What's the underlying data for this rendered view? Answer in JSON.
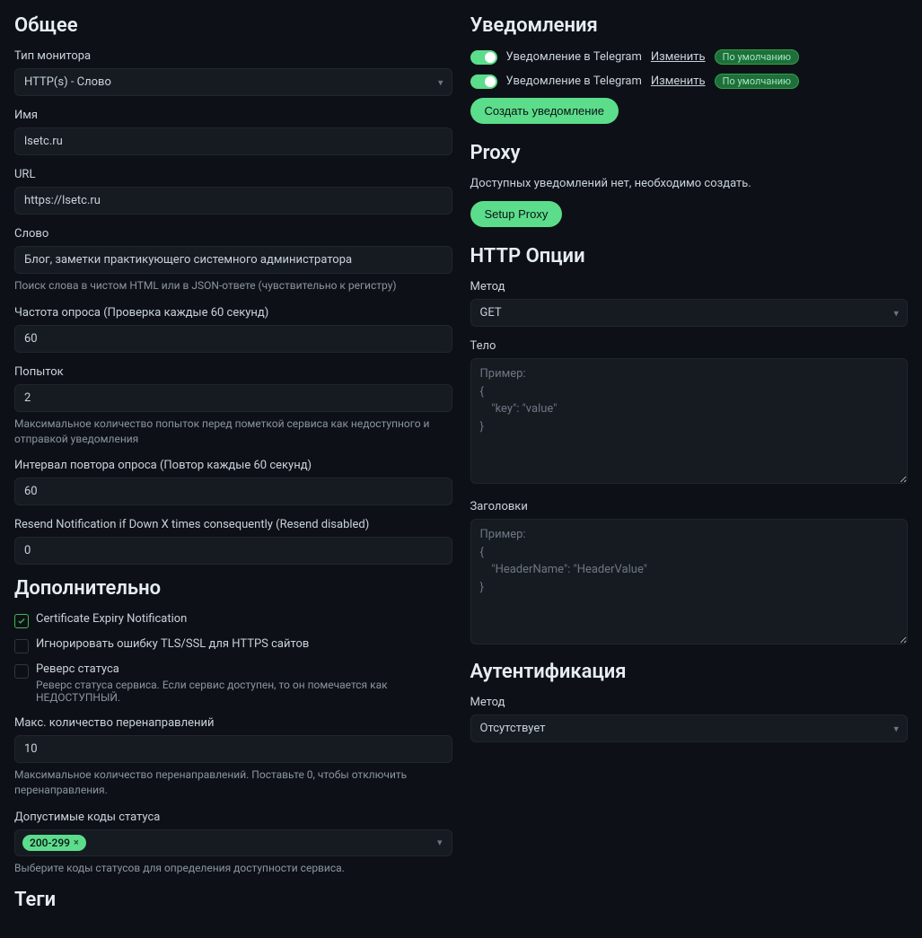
{
  "left": {
    "general": {
      "title": "Общее",
      "monitor_type": {
        "label": "Тип монитора",
        "value": "HTTP(s) - Слово"
      },
      "name": {
        "label": "Имя",
        "value": "lsetc.ru"
      },
      "url": {
        "label": "URL",
        "value": "https://lsetc.ru"
      },
      "word": {
        "label": "Слово",
        "value": "Блог, заметки практикующего системного администратора",
        "help": "Поиск слова в чистом HTML или в JSON-ответе (чувствительно к регистру)"
      },
      "interval": {
        "label": "Частота опроса (Проверка каждые 60 секунд)",
        "value": "60"
      },
      "retries": {
        "label": "Попыток",
        "value": "2",
        "help": "Максимальное количество попыток перед пометкой сервиса как недоступного и отправкой уведомления"
      },
      "retry_interval": {
        "label": "Интервал повтора опроса (Повтор каждые 60 секунд)",
        "value": "60"
      },
      "resend": {
        "label": "Resend Notification if Down X times consequently (Resend disabled)",
        "value": "0"
      }
    },
    "advanced": {
      "title": "Дополнительно",
      "cert_expiry": {
        "label": "Certificate Expiry Notification",
        "checked": true
      },
      "ignore_tls": {
        "label": "Игнорировать ошибку TLS/SSL для HTTPS сайтов",
        "checked": false
      },
      "upside_down": {
        "label": "Реверс статуса",
        "sub": "Реверс статуса сервиса. Если сервис доступен, то он помечается как НЕДОСТУПНЫЙ.",
        "checked": false
      },
      "max_redirects": {
        "label": "Макс. количество перенаправлений",
        "value": "10",
        "help": "Максимальное количество перенаправлений. Поставьте 0, чтобы отключить перенаправления."
      },
      "status_codes": {
        "label": "Допустимые коды статуса",
        "tag": "200-299",
        "help": "Выберите коды статусов для определения доступности сервиса."
      }
    },
    "tags": {
      "title": "Теги"
    }
  },
  "right": {
    "notifications": {
      "title": "Уведомления",
      "items": [
        {
          "text": "Уведомление в Telegram",
          "edit": "Изменить",
          "badge": "По умолчанию"
        },
        {
          "text": "Уведомление в Telegram",
          "edit": "Изменить",
          "badge": "По умолчанию"
        }
      ],
      "create_btn": "Создать уведомление"
    },
    "proxy": {
      "title": "Proxy",
      "desc": "Доступных уведомлений нет, необходимо создать.",
      "btn": "Setup Proxy"
    },
    "http": {
      "title": "HTTP Опции",
      "method": {
        "label": "Метод",
        "value": "GET"
      },
      "body": {
        "label": "Тело",
        "placeholder": "Пример:\n{\n    \"key\": \"value\"\n}"
      },
      "headers": {
        "label": "Заголовки",
        "placeholder": "Пример:\n{\n    \"HeaderName\": \"HeaderValue\"\n}"
      }
    },
    "auth": {
      "title": "Аутентификация",
      "method": {
        "label": "Метод",
        "value": "Отсутствует"
      }
    }
  }
}
